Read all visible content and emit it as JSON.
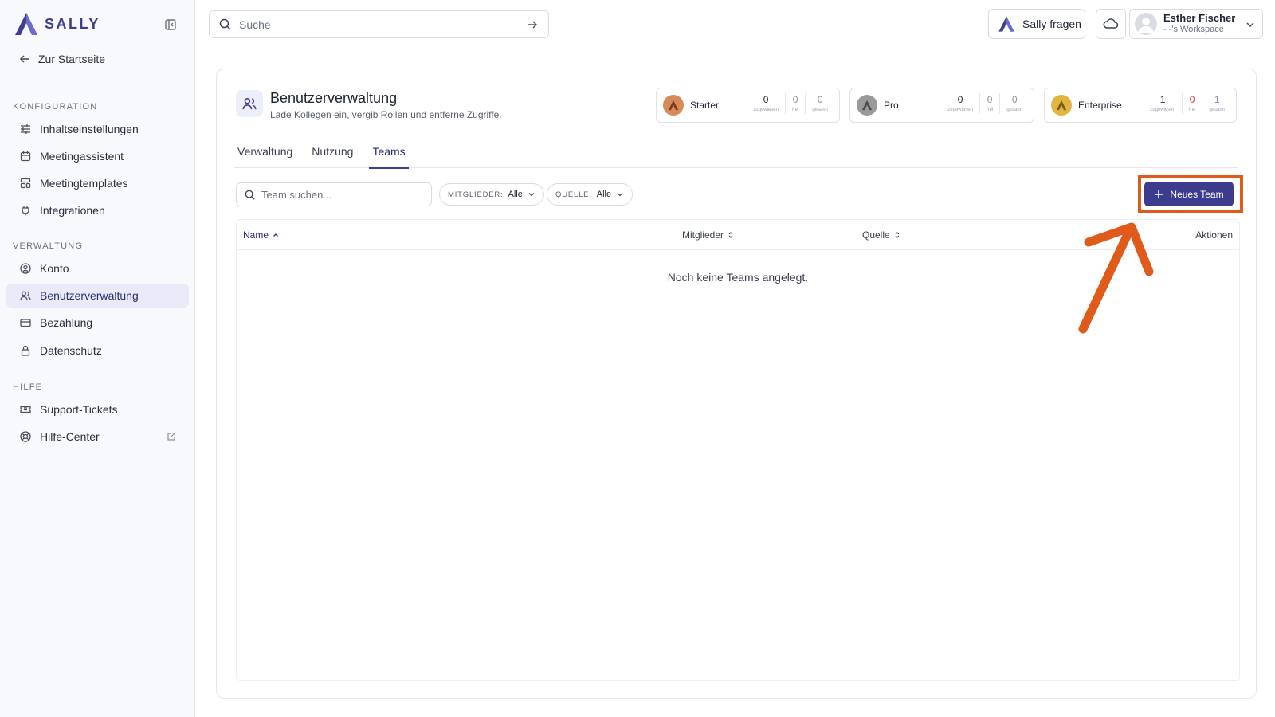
{
  "brand": {
    "name": "SALLY",
    "accent": "#3f3f8f"
  },
  "sidebar": {
    "back_label": "Zur Startseite",
    "sections": [
      {
        "title": "Konfiguration",
        "items": [
          {
            "label": "Inhaltseinstellungen",
            "icon": "sliders-icon"
          },
          {
            "label": "Meetingassistent",
            "icon": "calendar-icon"
          },
          {
            "label": "Meetingtemplates",
            "icon": "template-icon"
          },
          {
            "label": "Integrationen",
            "icon": "plug-icon"
          }
        ]
      },
      {
        "title": "Verwaltung",
        "items": [
          {
            "label": "Konto",
            "icon": "user-circle-icon"
          },
          {
            "label": "Benutzerverwaltung",
            "icon": "users-icon",
            "active": true
          },
          {
            "label": "Bezahlung",
            "icon": "credit-card-icon"
          },
          {
            "label": "Datenschutz",
            "icon": "lock-icon"
          }
        ]
      },
      {
        "title": "Hilfe",
        "items": [
          {
            "label": "Support-Tickets",
            "icon": "ticket-icon"
          },
          {
            "label": "Hilfe-Center",
            "icon": "lifebuoy-icon"
          }
        ]
      }
    ]
  },
  "topbar": {
    "search_placeholder": "Suche",
    "ask_label": "Sally fragen",
    "user": {
      "name": "Esther Fischer",
      "workspace": "- -'s Workspace"
    }
  },
  "page": {
    "title": "Benutzerverwaltung",
    "subtitle": "Lade Kollegen ein, vergib Rollen und entferne Zugriffe."
  },
  "plans": [
    {
      "name": "Starter",
      "color": "#d98a5a",
      "assigned": "0",
      "free": "0",
      "total": "0",
      "assigned_label": "zugewiesen",
      "free_label": "frei",
      "total_label": "gesamt"
    },
    {
      "name": "Pro",
      "color": "#9a9a9a",
      "assigned": "0",
      "free": "0",
      "total": "0",
      "assigned_label": "zugewiesen",
      "free_label": "frei",
      "total_label": "gesamt"
    },
    {
      "name": "Enterprise",
      "color": "#e0b640",
      "assigned": "1",
      "free": "0",
      "total": "1",
      "assigned_label": "zugewiesen",
      "free_label": "frei",
      "total_label": "gesamt"
    }
  ],
  "tabs": [
    "Verwaltung",
    "Nutzung",
    "Teams"
  ],
  "active_tab": "Teams",
  "teams": {
    "search_placeholder": "Team suchen...",
    "filters": [
      {
        "key": "Mitglieder:",
        "value": "Alle"
      },
      {
        "key": "Quelle:",
        "value": "Alle"
      }
    ],
    "new_team_label": "Neues Team",
    "columns": {
      "name": "Name",
      "members": "Mitglieder",
      "source": "Quelle",
      "actions": "Aktionen"
    },
    "empty_text": "Noch keine Teams angelegt."
  },
  "annotation_color": "#e05a1a"
}
